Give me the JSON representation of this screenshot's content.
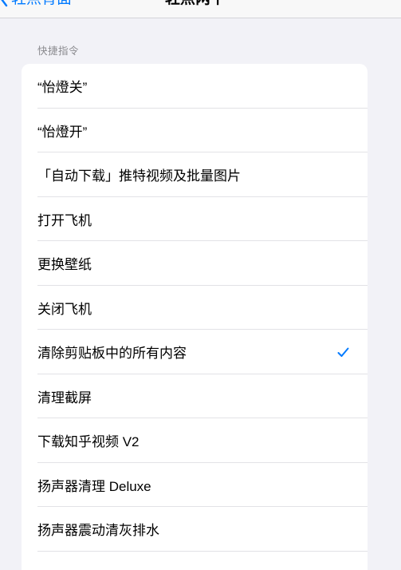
{
  "nav": {
    "back_label": "轻点背面",
    "back_icon": "chevron-left-icon",
    "title": "轻点两下"
  },
  "section": {
    "header": "快捷指令"
  },
  "shortcuts": [
    {
      "label": "“怡燈关”",
      "selected": false
    },
    {
      "label": "“怡燈开”",
      "selected": false
    },
    {
      "label": "「自动下载」推特视频及批量图片",
      "selected": false
    },
    {
      "label": "打开飞机",
      "selected": false
    },
    {
      "label": "更换壁纸",
      "selected": false
    },
    {
      "label": "关闭飞机",
      "selected": false
    },
    {
      "label": "清除剪贴板中的所有内容",
      "selected": true
    },
    {
      "label": "清理截屏",
      "selected": false
    },
    {
      "label": "下载知乎视频 V2",
      "selected": false
    },
    {
      "label": "扬声器清理 Deluxe",
      "selected": false
    },
    {
      "label": "扬声器震动清灰排水",
      "selected": false
    },
    {
      "label": "",
      "selected": false
    }
  ],
  "selected_icon": "checkmark-icon",
  "colors": {
    "accent": "#007aff",
    "background": "#f2f2f7",
    "card": "#ffffff",
    "secondary_text": "#8a8a8e"
  }
}
